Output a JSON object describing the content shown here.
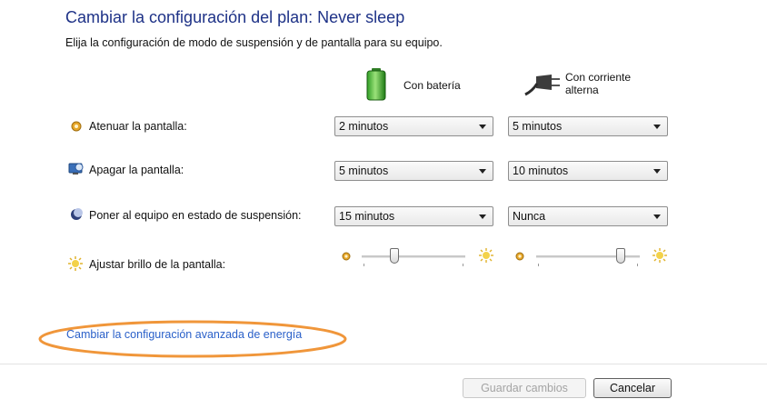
{
  "header": {
    "title": "Cambiar la configuración del plan: Never sleep",
    "subtitle": "Elija la configuración de modo de suspensión y de pantalla para su equipo."
  },
  "columns": {
    "battery": {
      "label": "Con batería",
      "icon": "battery-icon"
    },
    "plugged": {
      "label_line1": "Con corriente",
      "label_line2": "alterna",
      "icon": "power-plug-icon"
    }
  },
  "settings": [
    {
      "label": "Atenuar la pantalla:",
      "icon": "dim-display-icon",
      "battery_value": "2 minutos",
      "plugged_value": "5 minutos"
    },
    {
      "label": "Apagar la pantalla:",
      "icon": "display-off-icon",
      "battery_value": "5 minutos",
      "plugged_value": "10 minutos"
    },
    {
      "label": "Poner al equipo en estado de suspensión:",
      "icon": "sleep-moon-icon",
      "battery_value": "15 minutos",
      "plugged_value": "Nunca"
    }
  ],
  "brightness": {
    "label": "Ajustar brillo de la pantalla:",
    "icon": "brightness-sun-icon",
    "battery_level": 0.3,
    "plugged_level": 0.85
  },
  "advanced_link": "Cambiar la configuración avanzada de energía",
  "buttons": {
    "save": "Guardar cambios",
    "cancel": "Cancelar"
  },
  "colors": {
    "title": "#1e3287",
    "link": "#2a60c9",
    "highlight_ellipse": "#f0963a"
  }
}
